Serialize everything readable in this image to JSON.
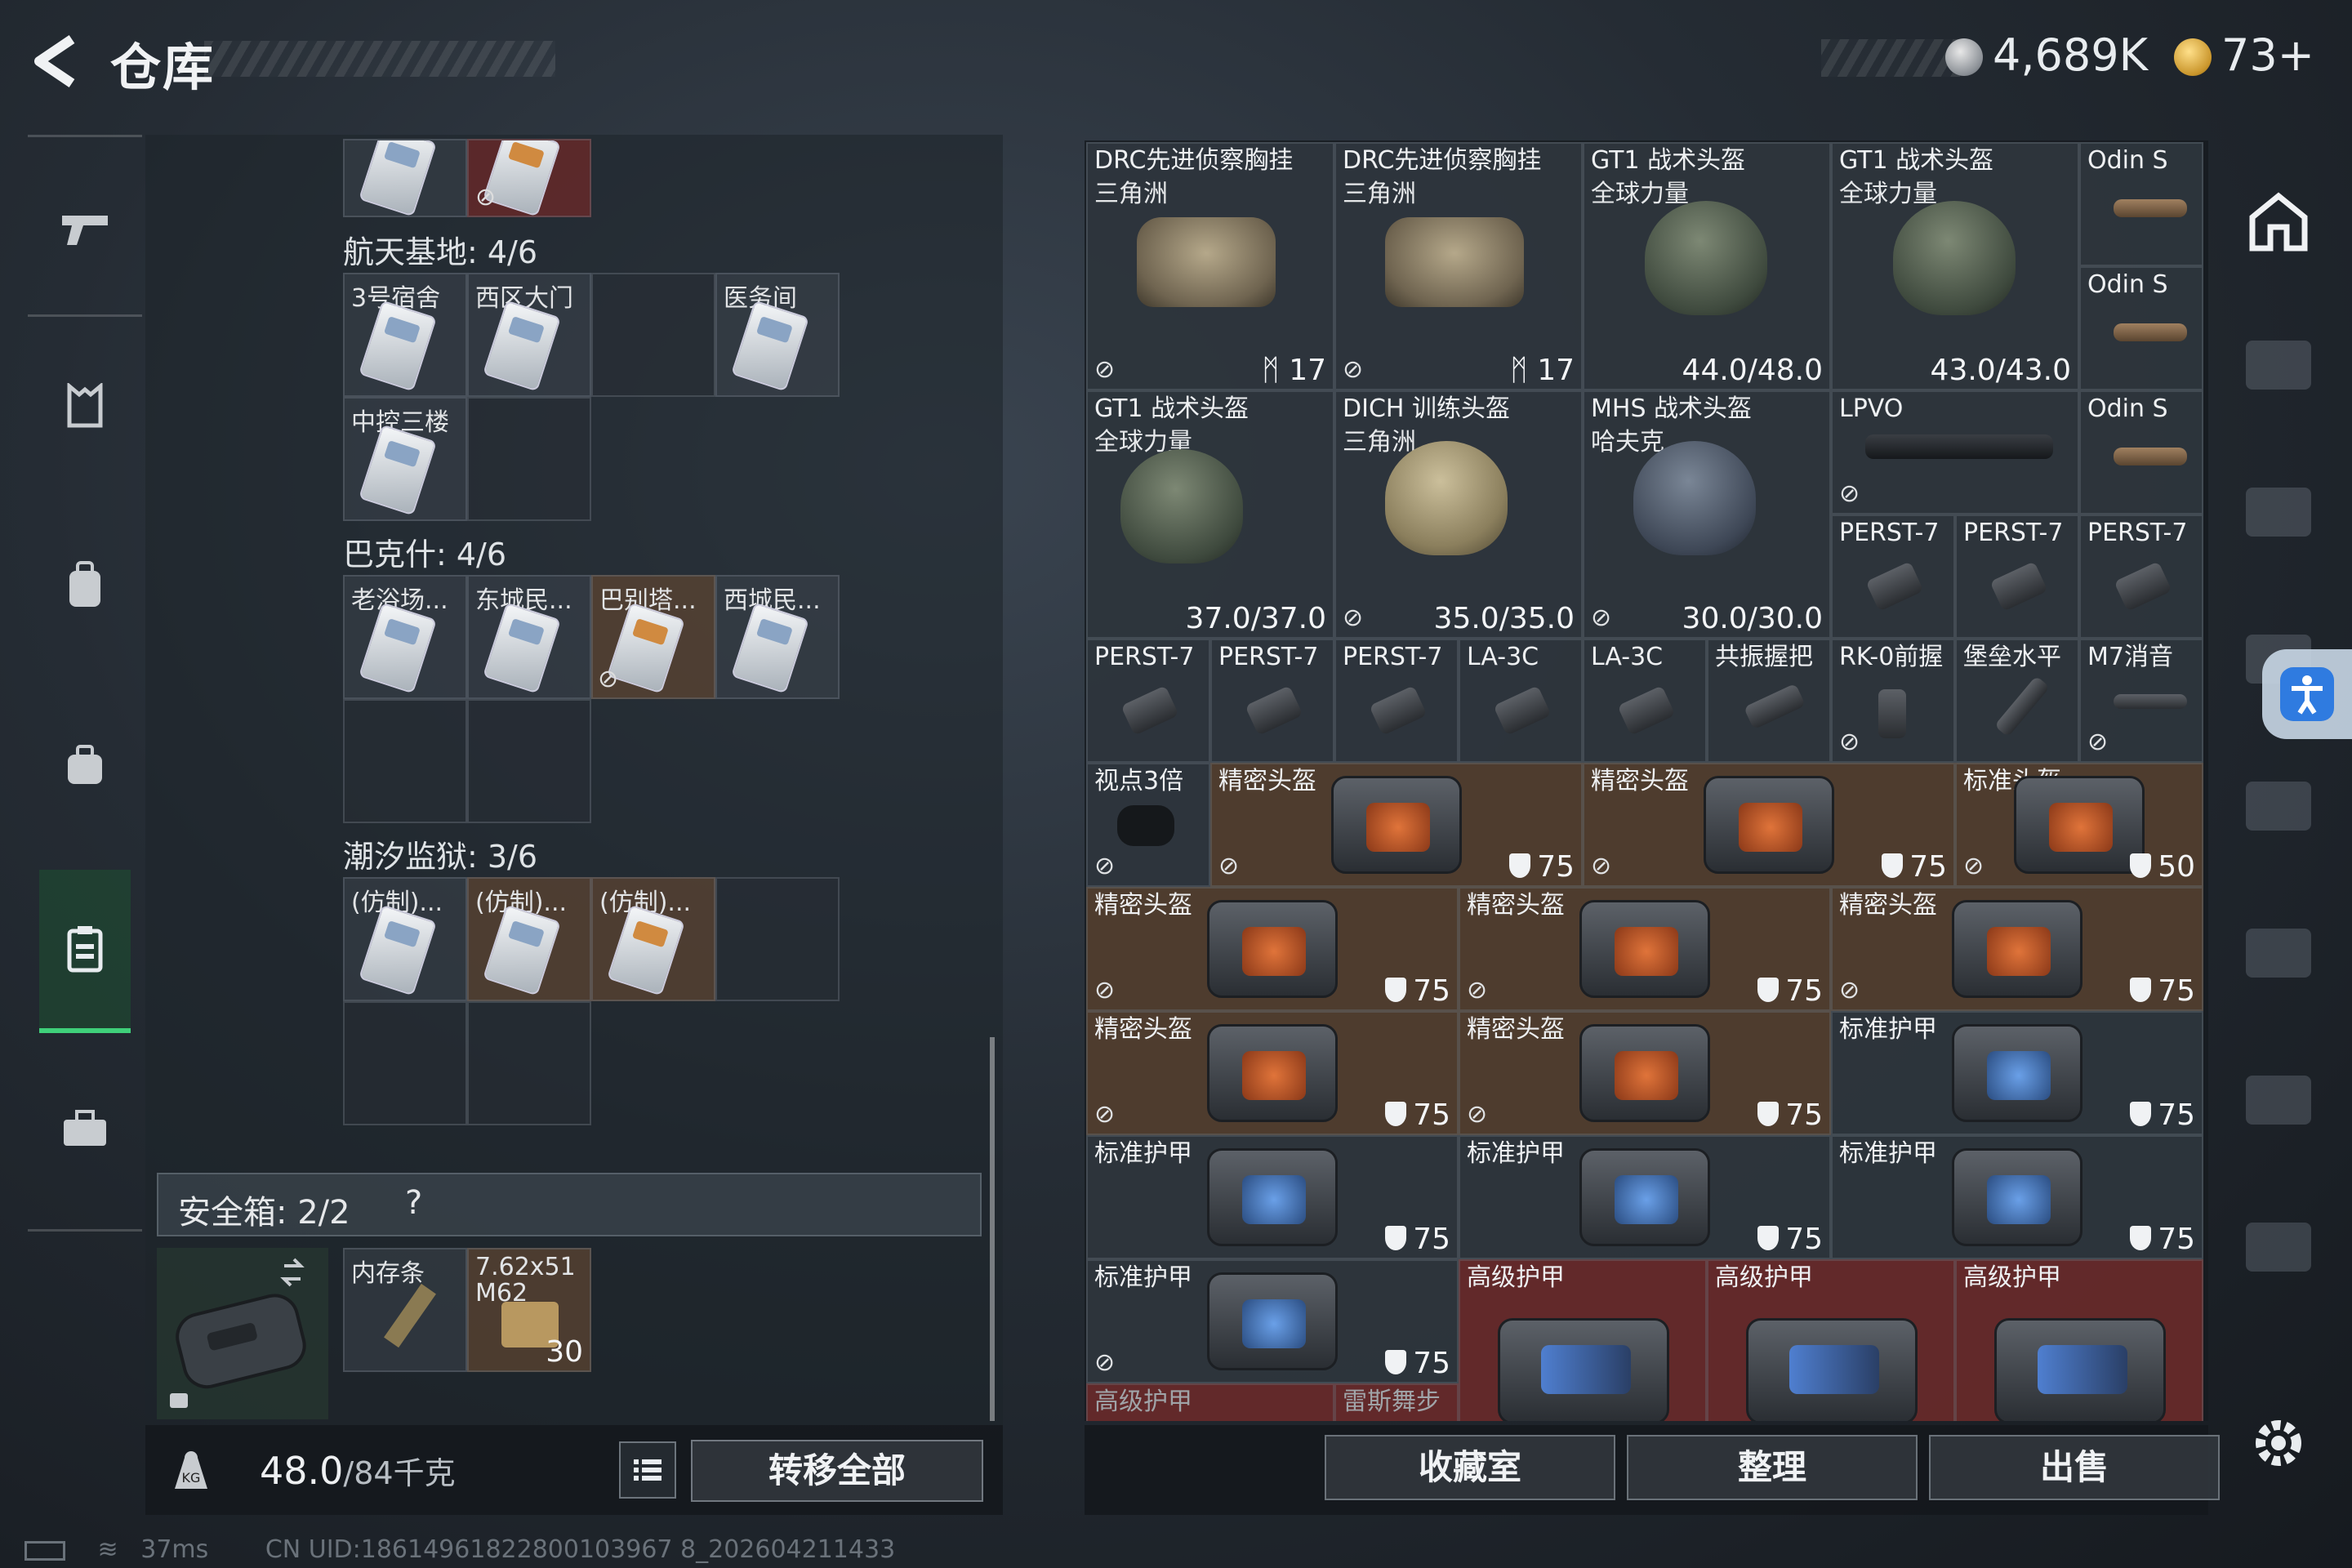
{
  "header": {
    "title": "仓库",
    "currency_silver": "4,689K",
    "currency_gold": "73+"
  },
  "left_rail": [
    "pistol-icon",
    "vest-icon",
    "backpack-icon",
    "case-icon",
    "keycard-icon",
    "briefcase-icon"
  ],
  "storage": {
    "sections": [
      {
        "title": "航天基地: 4/6",
        "slots": [
          "3号宿舍",
          "西区大门",
          "",
          "医务间",
          "中控三楼",
          ""
        ]
      },
      {
        "title": "巴克什: 4/6",
        "slots": [
          "老浴场...",
          "东城民...",
          "巴别塔...",
          "西城民...",
          "",
          ""
        ]
      },
      {
        "title": "潮汐监狱: 3/6",
        "slots": [
          "(仿制)...",
          "(仿制)...",
          "(仿制)...",
          "",
          "",
          ""
        ]
      }
    ],
    "safe_box": {
      "label": "安全箱: 2/2",
      "help": "?",
      "items": [
        {
          "name": "内存条",
          "qty": ""
        },
        {
          "name": "7.62x51",
          "name2": "M62",
          "qty": "30"
        }
      ]
    },
    "weight": "48.0",
    "weight_total": "/84千克",
    "transfer_all": "转移全部"
  },
  "grid": {
    "row1": [
      {
        "name": "DRC先进侦察胸挂",
        "sub": "三角洲",
        "val": "17"
      },
      {
        "name": "DRC先进侦察胸挂",
        "sub": "三角洲",
        "val": "17"
      },
      {
        "name": "GT1 战术头盔",
        "sub": "全球力量",
        "val": "44.0/48.0"
      },
      {
        "name": "GT1 战术头盔",
        "sub": "全球力量",
        "val": "43.0/43.0"
      },
      {
        "name": "Odin S"
      },
      {
        "name": "Odin S"
      }
    ],
    "row2": [
      {
        "name": "GT1 战术头盔",
        "sub": "全球力量",
        "val": "37.0/37.0"
      },
      {
        "name": "DICH 训练头盔",
        "sub": "三角洲",
        "val": "35.0/35.0"
      },
      {
        "name": "MHS 战术头盔",
        "sub": "哈夫克",
        "val": "30.0/30.0"
      },
      {
        "name": "LPVO"
      },
      {
        "name": "Odin S"
      },
      {
        "name": "PERST-7"
      },
      {
        "name": "PERST-7"
      },
      {
        "name": "PERST-7"
      }
    ],
    "row3": [
      "PERST-7",
      "PERST-7",
      "PERST-7",
      "LA-3C",
      "LA-3C",
      "共振握把",
      "RK-0前握",
      "堡垒水平",
      "M7消音"
    ],
    "row4": [
      {
        "name": "视点3倍"
      },
      {
        "name": "精密头盔",
        "val": "75"
      },
      {
        "name": "精密头盔",
        "val": "75"
      },
      {
        "name": "标准头盔",
        "val": "50"
      }
    ],
    "row5": [
      {
        "name": "精密头盔",
        "val": "75"
      },
      {
        "name": "精密头盔",
        "val": "75"
      },
      {
        "name": "精密头盔",
        "val": "75"
      }
    ],
    "row6": [
      {
        "name": "精密头盔",
        "val": "75"
      },
      {
        "name": "精密头盔",
        "val": "75"
      },
      {
        "name": "标准护甲",
        "val": "75"
      }
    ],
    "row7": [
      {
        "name": "标准护甲",
        "val": "75"
      },
      {
        "name": "标准护甲",
        "val": "75"
      },
      {
        "name": "标准护甲",
        "val": "75"
      }
    ],
    "row8": [
      {
        "name": "标准护甲",
        "val": "75"
      },
      {
        "name": "高级护甲"
      },
      {
        "name": "高级护甲"
      },
      {
        "name": "高级护甲"
      }
    ],
    "row9": [
      "高级护甲",
      "雷斯舞步"
    ]
  },
  "buttons": {
    "collection": "收藏室",
    "organize": "整理",
    "sell": "出售"
  },
  "right_rail": [
    "safehouse-icon",
    "tier-iv-armor-icon",
    "tier-iv-rig-icon",
    "tier-iv-helmet-icon",
    "gti-armor-icon",
    "gti-helmet-icon",
    "tier-iv-helmet2-icon",
    "tier-iv-helmet3-icon"
  ],
  "status": {
    "ping": "37ms",
    "uid": "CN UID:18614961822800103967 8_202604211433"
  }
}
